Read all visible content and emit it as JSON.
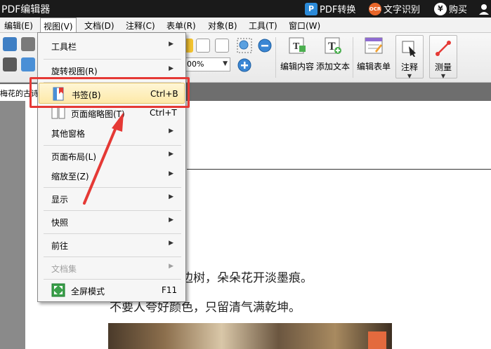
{
  "titlebar": {
    "app_title": "PDF编辑器",
    "pdf_convert": "PDF转换",
    "ocr": "文字识别",
    "buy": "购买",
    "ocr_icon_text": "OCR",
    "pdf_icon_text": "P",
    "yen_icon_text": "¥"
  },
  "menubar": {
    "items": [
      "编辑(E)",
      "视图(V)",
      "文档(D)",
      "注释(C)",
      "表单(R)",
      "对象(B)",
      "工具(T)",
      "窗口(W)"
    ]
  },
  "toolbar": {
    "zoom_value": "00%",
    "edit_content": "编辑内容",
    "add_text": "添加文本",
    "edit_form": "编辑表单",
    "annotate": "注释",
    "measure": "测量"
  },
  "tabbar": {
    "doc_tab": "梅花的古诗"
  },
  "document": {
    "line1": "树，朵朵花开淡墨痕。",
    "line1_prefix": "边",
    "line2": "不要人夸好颜色，只留清气满乾坤。"
  },
  "view_menu": {
    "items": [
      {
        "label": "工具栏",
        "shortcut": "",
        "submenu": true,
        "disabled": false
      },
      {
        "label": "旋转视图(R)",
        "shortcut": "",
        "submenu": true,
        "disabled": false
      },
      {
        "label": "书签(B)",
        "shortcut": "Ctrl+B",
        "submenu": false,
        "disabled": false,
        "highlighted": true
      },
      {
        "label": "页面缩略图(T)",
        "shortcut": "Ctrl+T",
        "submenu": false,
        "disabled": false
      },
      {
        "label": "其他窗格",
        "shortcut": "",
        "submenu": true,
        "disabled": false
      },
      {
        "label": "页面布局(L)",
        "shortcut": "",
        "submenu": true,
        "disabled": false
      },
      {
        "label": "缩放至(Z)",
        "shortcut": "",
        "submenu": true,
        "disabled": false
      },
      {
        "label": "显示",
        "shortcut": "",
        "submenu": true,
        "disabled": false
      },
      {
        "label": "快照",
        "shortcut": "",
        "submenu": true,
        "disabled": false
      },
      {
        "label": "前往",
        "shortcut": "",
        "submenu": true,
        "disabled": false
      },
      {
        "label": "文档集",
        "shortcut": "",
        "submenu": true,
        "disabled": true
      },
      {
        "label": "全屏模式",
        "shortcut": "F11",
        "submenu": false,
        "disabled": false
      }
    ]
  },
  "colors": {
    "highlight_box": "#e53935",
    "titlebar_bg": "#1a1a1a",
    "menu_highlight": "#fde9a8"
  }
}
